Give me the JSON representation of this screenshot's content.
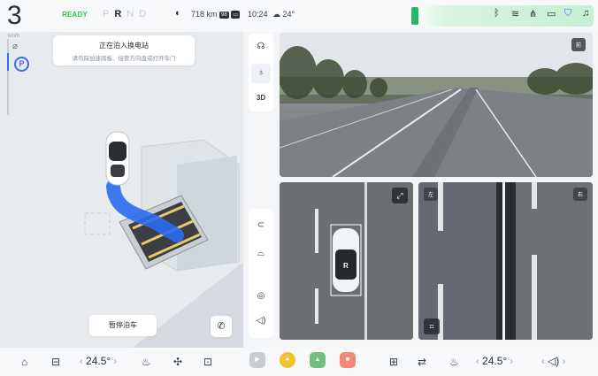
{
  "status_bar": {
    "speed": "3",
    "speed_unit": "km/h",
    "drive_ready": "READY",
    "gears": [
      "P",
      "R",
      "N",
      "D"
    ],
    "active_gear": "R",
    "range": "718 km",
    "battery_badge": "98",
    "time": "10:24",
    "outside_temp": "24°"
  },
  "parking": {
    "toast_title": "正在泊入换电站",
    "toast_subtitle": "请勿踩加速踏板、接管方向盘或打开车门",
    "pause_button": "暂停泊车",
    "gear_mark": "R"
  },
  "tools": {
    "three_d_label": "3D"
  },
  "cameras": {
    "front_label": "前",
    "left_label": "左",
    "right_label": "右"
  },
  "dock": {
    "driver_temp": "24.5°",
    "passenger_temp": "24.5°",
    "apps": [
      "video",
      "media",
      "map",
      "game"
    ]
  }
}
